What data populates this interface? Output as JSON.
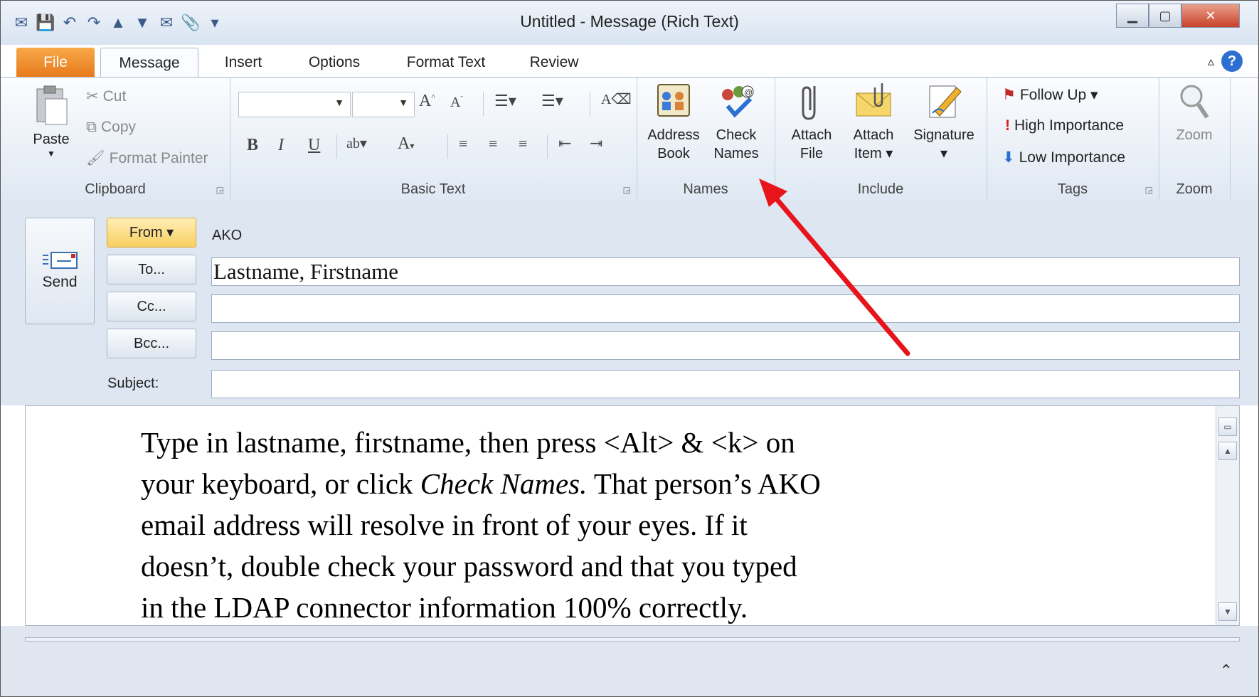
{
  "window": {
    "title": "Untitled  -  Message (Rich Text)"
  },
  "tabs": [
    "File",
    "Message",
    "Insert",
    "Options",
    "Format Text",
    "Review"
  ],
  "clipboard": {
    "paste": "Paste",
    "cut": "Cut",
    "copy": "Copy",
    "format_painter": "Format Painter",
    "label": "Clipboard"
  },
  "basic_text": {
    "label": "Basic Text",
    "bold": "B",
    "italic": "I",
    "underline": "U"
  },
  "names": {
    "address_book_1": "Address",
    "address_book_2": "Book",
    "check_names_1": "Check",
    "check_names_2": "Names",
    "label": "Names"
  },
  "include": {
    "attach_file_1": "Attach",
    "attach_file_2": "File",
    "attach_item_1": "Attach",
    "attach_item_2": "Item ▾",
    "signature": "Signature",
    "signature_dd": "▾",
    "label": "Include"
  },
  "tags": {
    "follow_up": "Follow Up ▾",
    "high": "High Importance",
    "low": "Low Importance",
    "label": "Tags"
  },
  "zoom": {
    "button": "Zoom",
    "label": "Zoom"
  },
  "header": {
    "send": "Send",
    "from_btn": "From ▾",
    "from_value": "AKO",
    "to_btn": "To...",
    "cc_btn": "Cc...",
    "bcc_btn": "Bcc...",
    "subject_label": "Subject:",
    "to_value": "Lastname, Firstname",
    "cc_value": "",
    "bcc_value": "",
    "subject_value": ""
  },
  "body": {
    "line1": "Type in lastname, firstname, then press <Alt> & <k> on",
    "line2a": "your keyboard, or click ",
    "line2b": "Check Names.",
    "line2c": "  That person’s AKO",
    "line3": "email address will resolve in front of your eyes.  If it",
    "line4": "doesn’t, double check your password and that you typed",
    "line5": "in the LDAP connector information 100% correctly."
  },
  "colors": {
    "file_tab": "#e6791a",
    "from_btn": "#f8cf60",
    "annotation_arrow": "#e8141c",
    "help": "#2c6fd0"
  }
}
